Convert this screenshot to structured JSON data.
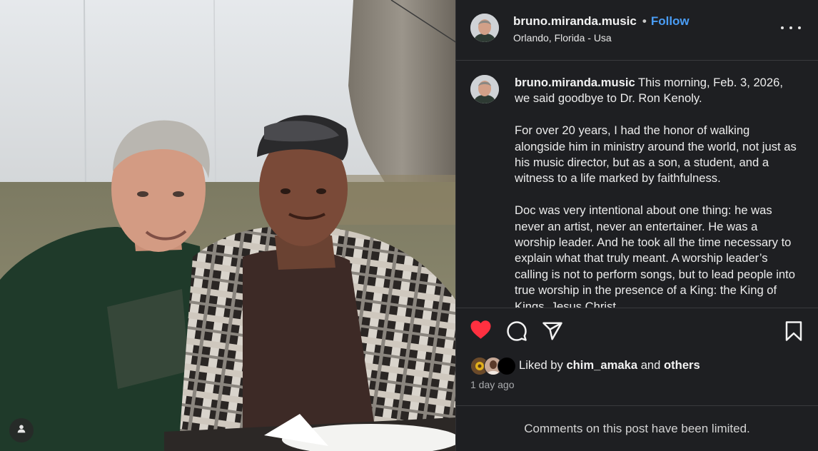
{
  "post": {
    "username": "bruno.miranda.music",
    "separator": "•",
    "follow_label": "Follow",
    "location": "Orlando, Florida - Usa"
  },
  "caption": {
    "username": "bruno.miranda.music",
    "paragraphs": [
      "This morning, Feb. 3, 2026, we said goodbye to Dr. Ron Kenoly.",
      "For over 20 years, I had the honor of walking alongside him in ministry around the world, not just as his music director, but as a son, a student, and a witness to a life marked by faithfulness.",
      "Doc was very intentional about one thing: he was never an artist, never an entertainer. He was a worship leader. And he took all the time necessary to explain what that truly meant. A worship leader’s calling is not to perform songs, but to lead people into true worship in the presence of a King: the King of Kings, Jesus Christ."
    ]
  },
  "likes": {
    "prefix": "Liked by",
    "user": "chim_amaka",
    "connector": "and",
    "others": "others"
  },
  "timestamp": "1 day ago",
  "comments_notice": "Comments on this post have been limited.",
  "colors": {
    "panel_bg": "#1e1f22",
    "accent_blue": "#4a9df5",
    "like_red": "#ff3040",
    "divider": "#3a3b3e"
  },
  "icons": {
    "tag": "person-tag-icon",
    "like": "heart-icon",
    "comment": "comment-icon",
    "share": "share-icon",
    "save": "bookmark-icon",
    "more": "more-options-icon"
  }
}
